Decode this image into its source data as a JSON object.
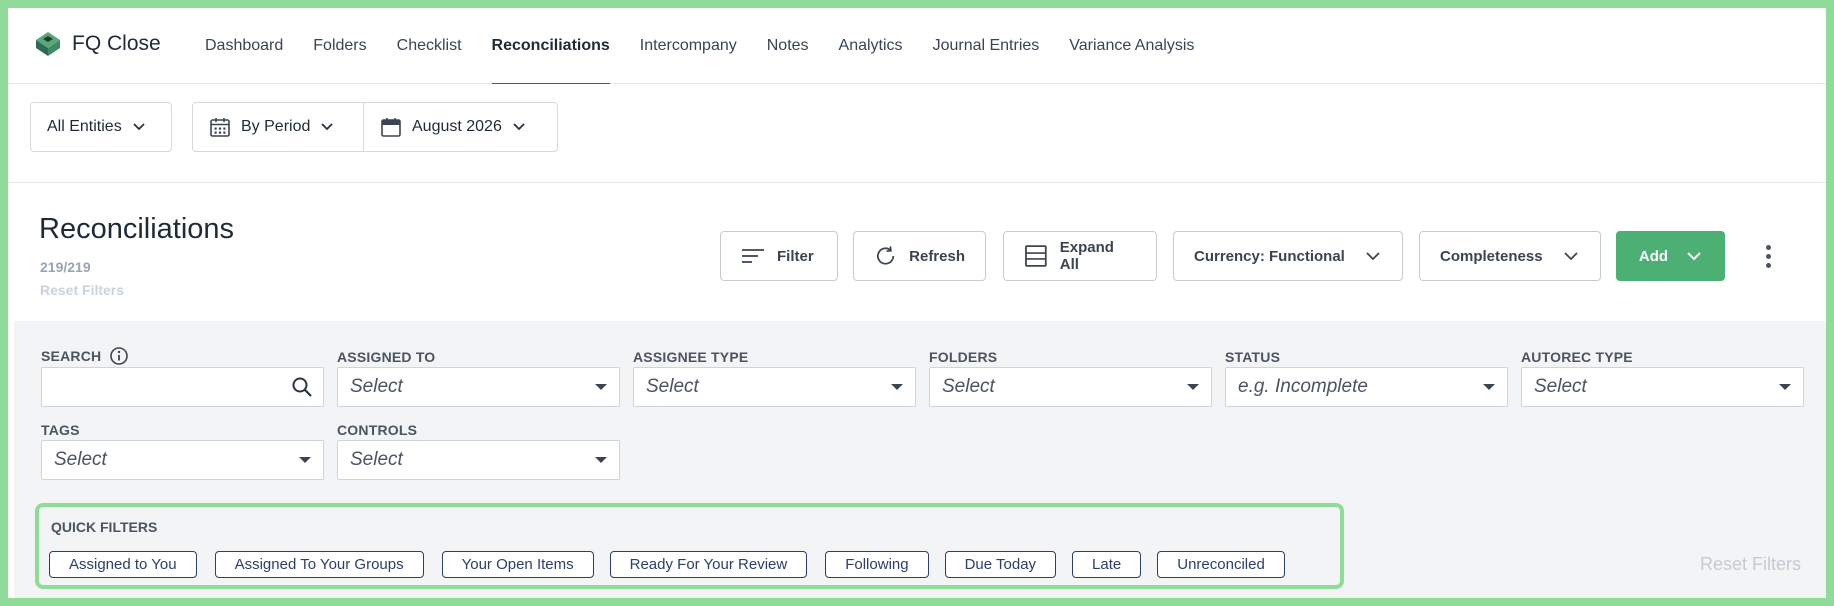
{
  "app": {
    "name": "FQ Close",
    "logo_icon": "fq-logo-icon"
  },
  "nav": {
    "items": [
      {
        "label": "Dashboard",
        "active": false
      },
      {
        "label": "Folders",
        "active": false
      },
      {
        "label": "Checklist",
        "active": false
      },
      {
        "label": "Reconciliations",
        "active": true
      },
      {
        "label": "Intercompany",
        "active": false
      },
      {
        "label": "Notes",
        "active": false
      },
      {
        "label": "Analytics",
        "active": false
      },
      {
        "label": "Journal Entries",
        "active": false
      },
      {
        "label": "Variance Analysis",
        "active": false
      }
    ]
  },
  "selectors": {
    "entities": "All Entities",
    "period_mode": "By Period",
    "period": "August 2026"
  },
  "header": {
    "title": "Reconciliations",
    "count": "219/219",
    "reset_filters": "Reset Filters"
  },
  "toolbar": {
    "filter": "Filter",
    "refresh": "Refresh",
    "expand_all": "Expand All",
    "currency": "Currency: Functional",
    "completeness": "Completeness",
    "add": "Add"
  },
  "filters": {
    "search": {
      "label": "SEARCH",
      "value": ""
    },
    "assigned_to": {
      "label": "ASSIGNED TO",
      "placeholder": "Select"
    },
    "assignee_type": {
      "label": "ASSIGNEE TYPE",
      "placeholder": "Select"
    },
    "folders": {
      "label": "FOLDERS",
      "placeholder": "Select"
    },
    "status": {
      "label": "STATUS",
      "placeholder": "e.g. Incomplete"
    },
    "autorec_type": {
      "label": "AUTOREC TYPE",
      "placeholder": "Select"
    },
    "tags": {
      "label": "TAGS",
      "placeholder": "Select"
    },
    "controls": {
      "label": "CONTROLS",
      "placeholder": "Select"
    }
  },
  "quick_filters": {
    "label": "QUICK FILTERS",
    "items": [
      "Assigned to You",
      "Assigned To Your Groups",
      "Your Open Items",
      "Ready For Your Review",
      "Following",
      "Due Today",
      "Late",
      "Unreconciled"
    ]
  },
  "reset_filters_bottom": "Reset Filters",
  "colors": {
    "accent": "#2e6b57",
    "add_button": "#4caf73",
    "chip_border": "#2c3e6b",
    "highlight": "#8fdc98"
  }
}
